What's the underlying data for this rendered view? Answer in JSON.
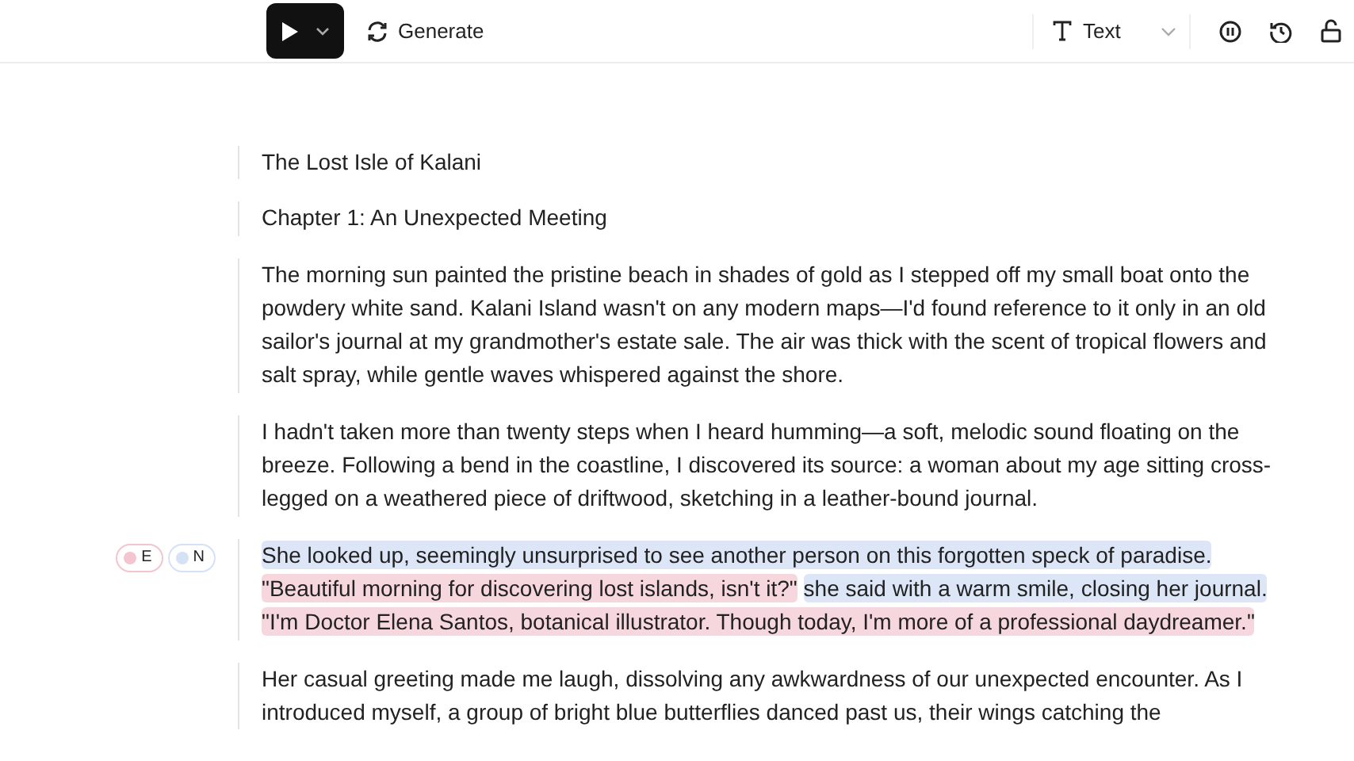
{
  "toolbar": {
    "generate_label": "Generate",
    "mode": {
      "label": "Text"
    }
  },
  "blocks": [
    {
      "kind": "plain",
      "text": "The Lost Isle of Kalani"
    },
    {
      "kind": "plain",
      "text": "Chapter 1: An Unexpected Meeting"
    },
    {
      "kind": "plain",
      "text": "The morning sun painted the pristine beach in shades of gold as I stepped off my small boat onto the powdery white sand. Kalani Island wasn't on any modern maps—I'd found reference to it only in an old sailor's journal at my grandmother's estate sale. The air was thick with the scent of tropical flowers and salt spray, while gentle waves whispered against the shore."
    },
    {
      "kind": "plain",
      "text": "I hadn't taken more than twenty steps when I heard humming—a soft, melodic sound floating on the breeze. Following a bend in the coastline, I discovered its source: a woman about my age sitting cross-legged on a weathered piece of driftwood, sketching in a leather-bound journal."
    },
    {
      "kind": "voiced",
      "badges": [
        {
          "label": "E",
          "color": "#f3c6cf"
        },
        {
          "label": "N",
          "color": "#d5e2f6"
        }
      ],
      "segments": [
        {
          "color": "#dde6f7",
          "text": "She looked up, seemingly unsurprised to see another person on this forgotten speck of paradise."
        },
        {
          "color": "#f7d7de",
          "text": "\"Beautiful morning for discovering lost islands, isn't it?\""
        },
        {
          "color": "#dde6f7",
          "text": "she said with a warm smile, closing her journal."
        },
        {
          "color": "#f7d7de",
          "text": "\"I'm Doctor Elena Santos, botanical illustrator. Though today, I'm more of a professional daydreamer.\""
        }
      ]
    },
    {
      "kind": "plain",
      "text": "Her casual greeting made me laugh, dissolving any awkwardness of our unexpected encounter. As I introduced myself, a group of bright blue butterflies danced past us, their wings catching the"
    }
  ]
}
